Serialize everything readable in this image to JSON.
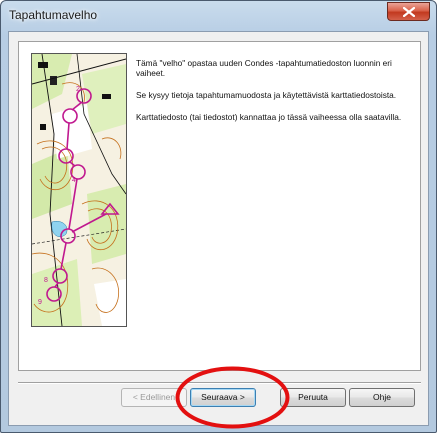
{
  "window": {
    "title": "Tapahtumavelho"
  },
  "content": {
    "paragraphs": [
      "Tämä \"velho\" opastaa uuden Condes -tapahtumatiedoston luonnin eri vaiheet.",
      "Se kysyy tietoja tapahtumamuodosta ja käytettävistä karttatiedostoista.",
      "Karttatiedosto (tai tiedostot) kannattaa jo tässä vaiheessa olla saatavilla."
    ]
  },
  "buttons": {
    "back": "< Edellinen",
    "next": "Seuraava >",
    "cancel": "Peruuta",
    "help": "Ohje"
  },
  "icons": {
    "close": "close-icon",
    "map": "orienteering-map-image"
  },
  "colors": {
    "annotation_circle": "#e31010",
    "map_course": "#c0188f",
    "map_vegetation": "#d8ecb0"
  }
}
